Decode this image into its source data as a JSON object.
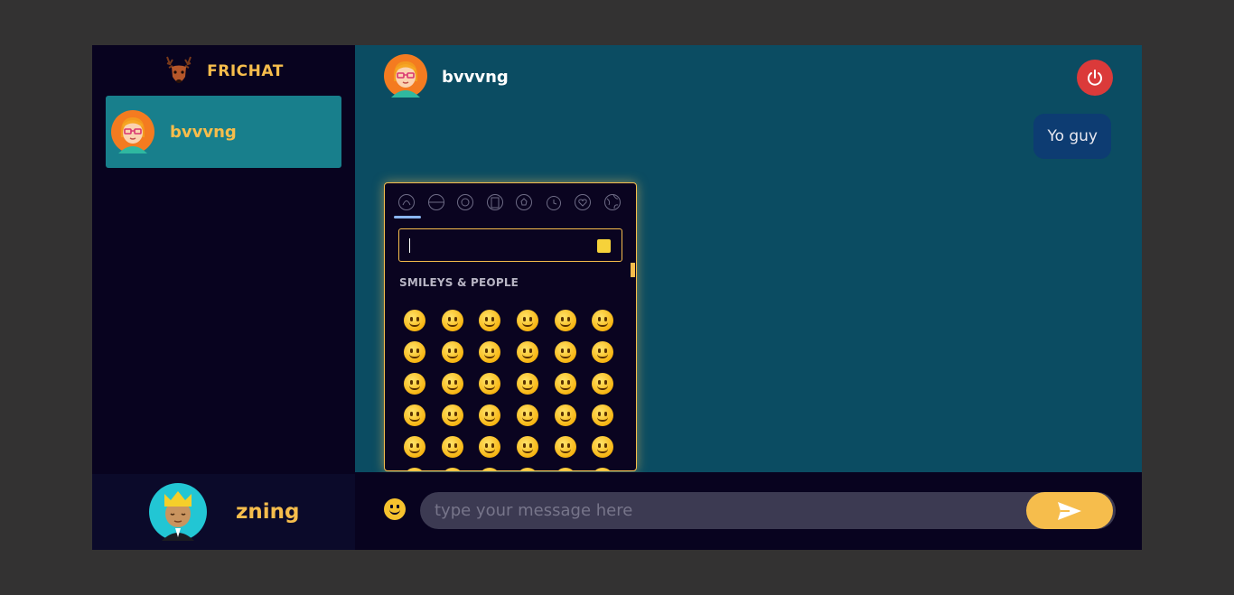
{
  "brand": {
    "name": "FRICHAT",
    "logo_icon": "deer-icon"
  },
  "sidebar": {
    "contacts": [
      {
        "name": "bvvvng",
        "avatar_icon": "girl-glasses-avatar-icon"
      }
    ]
  },
  "current_user": {
    "name": "zning",
    "avatar_icon": "crowned-boy-avatar-icon"
  },
  "chat": {
    "title": "bvvvng",
    "messages": [
      {
        "text": "Yo guy",
        "direction": "outgoing"
      }
    ]
  },
  "emoji_picker": {
    "categories": [
      "smileys-people",
      "animals-nature",
      "food-drink",
      "travel-places",
      "activities",
      "objects",
      "symbols",
      "flags"
    ],
    "active_category": "smileys-people",
    "section_label": "SMILEYS & PEOPLE",
    "search_value": "",
    "emojis": [
      "😀",
      "😃",
      "😄",
      "😁",
      "😆",
      "😅",
      "🤣",
      "😂",
      "🙂",
      "🙃",
      "😉",
      "😊",
      "😇",
      "🥰",
      "😍",
      "🤩",
      "😘",
      "😗",
      "☺️",
      "😚",
      "😙",
      "🥲",
      "😋",
      "😛",
      "😜",
      "🤪",
      "😝",
      "🤑",
      "🤗",
      "🤭",
      "🤫",
      "🤔",
      "🤐",
      "🤨",
      "😐",
      "😑"
    ]
  },
  "composer": {
    "placeholder": "type your message here",
    "value": ""
  },
  "colors": {
    "accent": "#f6bd4c",
    "sidebar_bg": "#08031f",
    "chat_bg": "#0b4c62",
    "active_contact": "#187f8c",
    "logout": "#db3a3a"
  }
}
